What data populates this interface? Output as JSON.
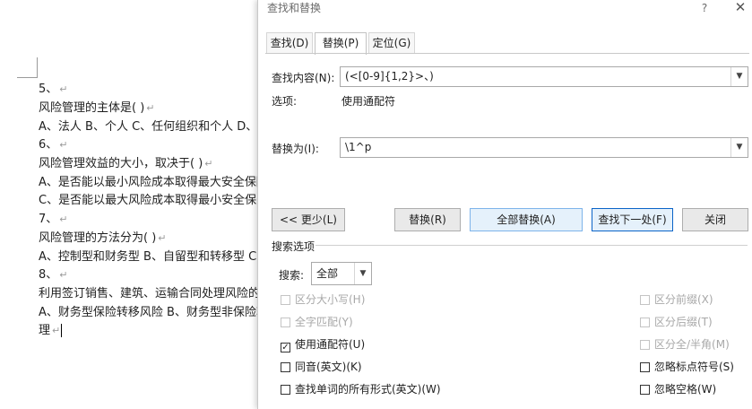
{
  "document": {
    "lines": [
      {
        "text": "5、",
        "mark": "↵"
      },
      {
        "text": "风险管理的主体是(   )",
        "mark": "↵"
      },
      {
        "text": "A、法人  B、个人  C、任何组织和个人  D、",
        "mark": ""
      },
      {
        "text": "6、",
        "mark": "↵"
      },
      {
        "text": "风险管理效益的大小，取决于(   )",
        "mark": "↵"
      },
      {
        "text": "A、是否能以最小风险成本取得最大安全保障",
        "mark": ""
      },
      {
        "text": "C、是否能以最大风险成本取得最小安全保障",
        "mark": ""
      },
      {
        "text": "7、",
        "mark": "↵"
      },
      {
        "text": "风险管理的方法分为(   )",
        "mark": "↵"
      },
      {
        "text": "A、控制型和财务型  B、自留型和转移型  C",
        "mark": ""
      },
      {
        "text": "8、",
        "mark": "↵"
      },
      {
        "text": "利用签订销售、建筑、运输合同处理风险的",
        "mark": ""
      },
      {
        "text": "A、财务型保险转移风险  B、财务型非保险转",
        "mark": ""
      },
      {
        "text": "理",
        "mark": "↵"
      }
    ]
  },
  "dialog": {
    "title": "查找和替换",
    "help": "?",
    "close": "✕",
    "tabs": [
      {
        "label": "查找(D)",
        "active": false
      },
      {
        "label": "替换(P)",
        "active": true
      },
      {
        "label": "定位(G)",
        "active": false
      }
    ],
    "find_label": "查找内容(N):",
    "find_value": "(<[0-9]{1,2}>、)",
    "options_label": "选项:",
    "options_value": "使用通配符",
    "replace_label": "替换为(I):",
    "replace_value": "\\1^p",
    "buttons": {
      "less": "<< 更少(L)",
      "replace": "替换(R)",
      "replace_all": "全部替换(A)",
      "find_next": "查找下一处(F)",
      "close": "关闭"
    },
    "search_options_title": "搜索选项",
    "search_label": "搜索:",
    "search_value": "全部",
    "left_options": [
      {
        "label": "区分大小写(H)",
        "checked": false,
        "disabled": true
      },
      {
        "label": "全字匹配(Y)",
        "checked": false,
        "disabled": true
      },
      {
        "label": "使用通配符(U)",
        "checked": true,
        "disabled": false
      },
      {
        "label": "同音(英文)(K)",
        "checked": false,
        "disabled": false
      },
      {
        "label": "查找单词的所有形式(英文)(W)",
        "checked": false,
        "disabled": false
      }
    ],
    "right_options": [
      {
        "label": "区分前缀(X)",
        "checked": false,
        "disabled": true
      },
      {
        "label": "区分后缀(T)",
        "checked": false,
        "disabled": true
      },
      {
        "label": "区分全/半角(M)",
        "checked": false,
        "disabled": true
      },
      {
        "label": "忽略标点符号(S)",
        "checked": false,
        "disabled": false
      },
      {
        "label": "忽略空格(W)",
        "checked": false,
        "disabled": false
      }
    ]
  }
}
